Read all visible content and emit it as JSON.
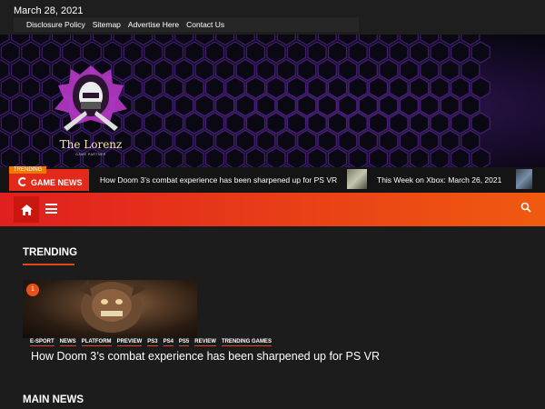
{
  "topbar": {
    "date": "March 28, 2021",
    "links": [
      "Disclosure Policy",
      "Sitemap",
      "Advertise Here",
      "Contact Us"
    ]
  },
  "logo": {
    "name": "The Lorenz",
    "tagline": "GAME PARTNER"
  },
  "ticker": {
    "badge": "TRENDING",
    "label": "GAME NEWS",
    "items": [
      "How Doom 3’s combat experience has been sharpened up for PS VR",
      "This Week on Xbox: March 26, 2021"
    ]
  },
  "navbar": {
    "home_icon": "home-icon",
    "menu_icon": "hamburger-icon",
    "search_icon": "search-icon"
  },
  "trending": {
    "title": "TRENDING",
    "card": {
      "rank": "1",
      "tags": [
        "E-SPORT",
        "NEWS",
        "PLATFORM",
        "PREVIEW",
        "PS3",
        "PS4",
        "PS5",
        "REVIEW",
        "TRENDING GAMES"
      ],
      "headline": "How Doom 3’s combat experience has been sharpened up for PS VR"
    }
  },
  "main_news": {
    "title": "MAIN NEWS"
  },
  "colors": {
    "accent": "#e2461c",
    "nav_start": "#e01f1f",
    "nav_end": "#f05a10",
    "background": "#1e1e1e"
  }
}
